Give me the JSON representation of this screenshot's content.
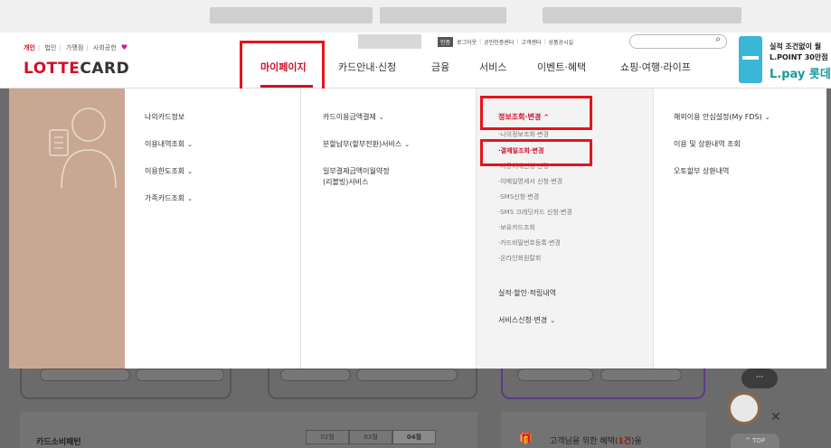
{
  "header": {
    "segments": [
      "개인",
      "법인",
      "가맹점",
      "사회공헌"
    ],
    "logo_text_lotte": "LOTTE",
    "logo_text_card": "CARD",
    "utility": {
      "badge": "인증",
      "links": [
        "로그아웃",
        "공인인증센터",
        "고객센터",
        "상품공시실"
      ]
    },
    "search_icon": "search-icon",
    "nav": [
      "마이페이지",
      "카드안내·신청",
      "금융",
      "서비스",
      "이벤트·혜택",
      "쇼핑·여행·라이프"
    ],
    "promo": {
      "line1": "실적 조건없이 월",
      "line2": "L.POINT 30만점",
      "line3": "L.pay 롯데"
    }
  },
  "mega": {
    "col1": [
      {
        "label": "나의카드정보",
        "chevron": false
      },
      {
        "label": "이용내역조회",
        "chevron": true
      },
      {
        "label": "이용한도조회",
        "chevron": true
      },
      {
        "label": "가족카드조회",
        "chevron": true
      }
    ],
    "col2": [
      {
        "label": "카드이용금액결제",
        "chevron": true
      },
      {
        "label": "분할납부(할부전환)서비스",
        "chevron": true
      },
      {
        "label": "일부결제금액이월약정",
        "chevron": false
      },
      {
        "label": "(리볼빙)서비스",
        "chevron": false
      }
    ],
    "col3": {
      "section_title": "정보조회·변경",
      "subs": [
        "·나의정보조회·변경",
        "·결제일조회·변경",
        "·자동이체신청·변경",
        "·이메일명세서 신청·변경",
        "·SMS신청·변경",
        "·SMS 크레딧카드 신청·변경",
        "·보유카드조회",
        "·카드비밀번호등록·변경",
        "·온라인회원탈회"
      ],
      "menus": [
        {
          "label": "실적·할인·적립내역",
          "chevron": false
        },
        {
          "label": "서비스신청·변경",
          "chevron": true
        }
      ]
    },
    "col4": [
      {
        "label": "해외이용 안심설정(My FDS)",
        "chevron": true
      },
      {
        "label": "이용 및 상환내역 조회",
        "chevron": false
      },
      {
        "label": "오토할부 상환내역",
        "chevron": false
      }
    ]
  },
  "bottom": {
    "title": "카드소비패턴",
    "tabs": [
      "02월",
      "03월",
      "04월"
    ],
    "benefit_prefix": "고객님을 위한 혜택(",
    "benefit_count": "1건",
    "benefit_suffix": ")을",
    "more_label": "···",
    "top_label": "^ TOP"
  },
  "colors": {
    "accent": "#d0102a",
    "highlight": "#e4141d"
  }
}
